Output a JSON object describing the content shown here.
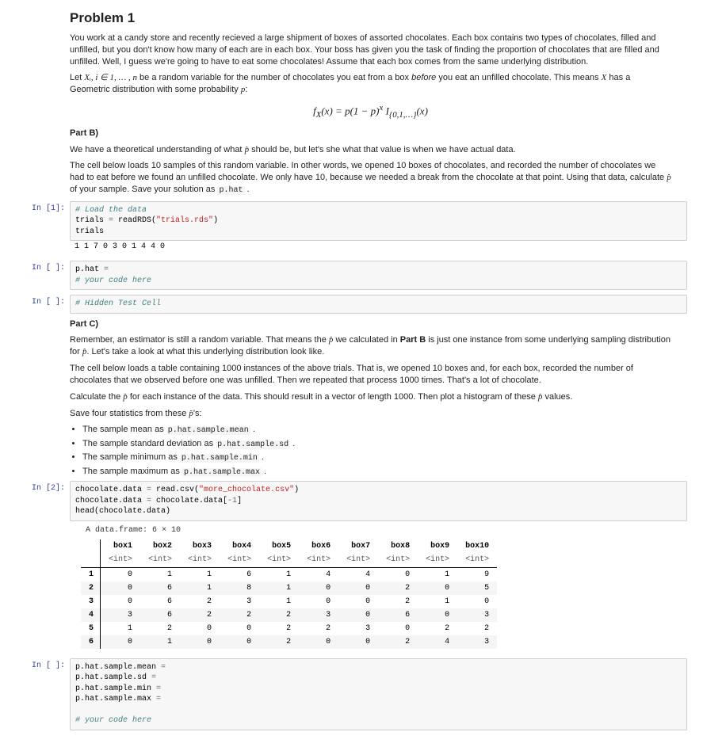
{
  "title": "Problem 1",
  "intro1": "You work at a candy store and recently recieved a large shipment of boxes of assorted chocolates. Each box contains two types of chocolates, filled and unfilled, but you don't know how many of each are in each box. Your boss has given you the task of finding the proportion of chocolates that are filled and unfilled. Well, I guess we're going to have to eat some chocolates! Assume that each box comes from the same underlying distribution.",
  "intro2_a": "Let ",
  "intro2_math": "Xᵢ, i ∈ 1, … , n",
  "intro2_b": " be a random variable for the number of chocolates you eat from a box ",
  "intro2_before": "before",
  "intro2_c": " you eat an unfilled chocolate. This means ",
  "intro2_X": "X",
  "intro2_d": " has a Geometric distribution with some probability ",
  "intro2_p": "p",
  "intro2_e": ":",
  "formula": "f_X(x) = p(1 − p)^x I_{0,1,…}(x)",
  "partB": "Part B)",
  "partB_p1_a": "We have a theoretical understanding of what ",
  "partB_p1_b": " should be, but let's she what that value is when we have actual data.",
  "partB_p2_a": "The cell below loads 10 samples of this random variable. In other words, we opened 10 boxes of chocolates, and recorded the number of chocolates we had to eat before we found an unfilled chocolate. We only have 10, because we needed a break from the chocolate at that point. Using that data, calculate ",
  "partB_p2_b": " of your sample. Save your solution as ",
  "partB_p2_code": "p.hat",
  "partB_p2_c": " .",
  "phat": "p̂",
  "cell1": {
    "prompt": "In [1]:",
    "code": {
      "l1_comment": "# Load the data",
      "l2_a": "trials ",
      "l2_b": "=",
      "l2_c": " readRDS(",
      "l2_d": "\"trials.rds\"",
      "l2_e": ")",
      "l3": "trials"
    },
    "output": "1 1 7 0 3 0 1 4 4 0"
  },
  "cell2": {
    "prompt": "In [ ]:",
    "code": {
      "l1_a": "p.hat ",
      "l1_b": "=",
      "l2_comment": "# your code here"
    }
  },
  "cell3": {
    "prompt": "In [ ]:",
    "code": {
      "l1_comment": "# Hidden Test Cell"
    }
  },
  "partC": "Part C)",
  "partC_p1_a": "Remember, an estimator is still a random variable. That means the ",
  "partC_p1_b": " we calculated in ",
  "partC_p1_bold": "Part B",
  "partC_p1_c": " is just one instance from some underlying sampling distribution for ",
  "partC_p1_d": ". Let's take a look at what this underlying distribution look like.",
  "partC_p2": "The cell below loads a table containing 1000 instances of the above trials. That is, we opened 10 boxes and, for each box, recorded the number of chocolates that we observed before one was unfilled. Then we repeated that process 1000 times. That's a lot of chocolate.",
  "partC_p3_a": "Calculate the ",
  "partC_p3_b": " for each instance of the data. This should result in a vector of length 1000. Then plot a histogram of these ",
  "partC_p3_c": " values.",
  "partC_p4_a": "Save four statistics from these ",
  "partC_p4_b": "'s:",
  "stats": [
    {
      "text": "The sample mean as ",
      "code": "p.hat.sample.mean",
      "suffix": " ."
    },
    {
      "text": "The sample standard deviation as ",
      "code": "p.hat.sample.sd",
      "suffix": " ."
    },
    {
      "text": "The sample minimum as ",
      "code": "p.hat.sample.min",
      "suffix": " ."
    },
    {
      "text": "The sample maximum as ",
      "code": "p.hat.sample.max",
      "suffix": " ."
    }
  ],
  "cell4": {
    "prompt": "In [2]:",
    "code": {
      "l1_a": "chocolate.data ",
      "l1_b": "=",
      "l1_c": " read.csv(",
      "l1_d": "\"more_chocolate.csv\"",
      "l1_e": ")",
      "l2_a": "chocolate.data ",
      "l2_b": "=",
      "l2_c": " chocolate.data[",
      "l2_d": "-1",
      "l2_e": "]",
      "l3": "head(chocolate.data)"
    }
  },
  "df": {
    "caption": "A data.frame: 6 × 10",
    "cols": [
      "box1",
      "box2",
      "box3",
      "box4",
      "box5",
      "box6",
      "box7",
      "box8",
      "box9",
      "box10"
    ],
    "type": "<int>",
    "rows": [
      [
        "1",
        "0",
        "1",
        "1",
        "6",
        "1",
        "4",
        "4",
        "0",
        "1",
        "9"
      ],
      [
        "2",
        "0",
        "6",
        "1",
        "8",
        "1",
        "0",
        "0",
        "2",
        "0",
        "5"
      ],
      [
        "3",
        "0",
        "6",
        "2",
        "3",
        "1",
        "0",
        "0",
        "2",
        "1",
        "0"
      ],
      [
        "4",
        "3",
        "6",
        "2",
        "2",
        "2",
        "3",
        "0",
        "6",
        "0",
        "3"
      ],
      [
        "5",
        "1",
        "2",
        "0",
        "0",
        "2",
        "2",
        "3",
        "0",
        "2",
        "2"
      ],
      [
        "6",
        "0",
        "1",
        "0",
        "0",
        "2",
        "0",
        "0",
        "2",
        "4",
        "3"
      ]
    ]
  },
  "cell5": {
    "prompt": "In [ ]:",
    "code": {
      "l1": "p.hat.sample.mean ",
      "l2": "p.hat.sample.sd ",
      "l3": "p.hat.sample.min ",
      "l4": "p.hat.sample.max ",
      "eq": "=",
      "comment": "# your code here"
    }
  }
}
